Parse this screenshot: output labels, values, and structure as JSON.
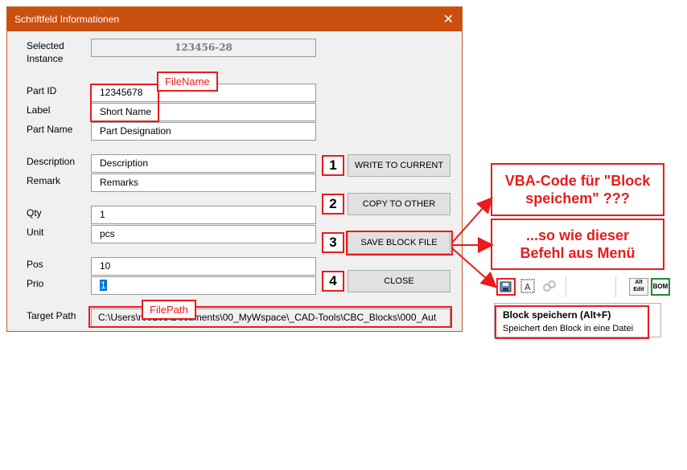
{
  "dialog": {
    "title": "Schriftfeld Informationen",
    "close_glyph": "✕"
  },
  "labels": {
    "selected_instance_1": "Selected",
    "selected_instance_2": "Instance",
    "part_id": "Part ID",
    "label": "Label",
    "part_name": "Part Name",
    "description": "Description",
    "remark": "Remark",
    "qty": "Qty",
    "unit": "Unit",
    "pos": "Pos",
    "prio": "Prio",
    "target_path": "Target Path"
  },
  "fields": {
    "selected_instance": "123456-28",
    "part_id": "12345678",
    "label": "Short Name",
    "part_name": "Part Designation",
    "description": "Description",
    "remark": "Remarks",
    "qty": "1",
    "unit": "pcs",
    "pos": "10",
    "prio": "1",
    "target_path": "C:\\Users\\r00103\\Documents\\00_MyWspace\\_CAD-Tools\\CBC_Blocks\\000_Aut"
  },
  "buttons": {
    "write_to_current": "WRITE TO CURRENT",
    "copy_to_other": "COPY TO OTHER",
    "save_block_file": "SAVE BLOCK FILE",
    "close": "CLOSE"
  },
  "annotations": {
    "filename": "FileName",
    "filepath": "FilePath",
    "num1": "1",
    "num2": "2",
    "num3": "3",
    "num4": "4",
    "callout1_line1": "VBA-Code für \"Block",
    "callout1_line2": "speichem\" ???",
    "callout2_line1": "...so wie dieser",
    "callout2_line2": "Befehl aus Menü"
  },
  "toolbar": {
    "icon_alt_edit": "Alt Edit",
    "icon_bom": "BOM"
  },
  "tooltip": {
    "title": "Block speichern   (Alt+F)",
    "description": "Speichert den Block in eine Datei"
  },
  "colors": {
    "titlebar": "#ca5010",
    "annotation_red": "#e81c1c"
  }
}
